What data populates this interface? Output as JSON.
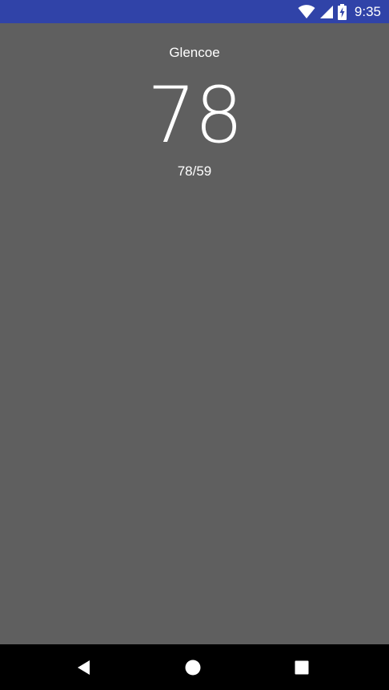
{
  "status_bar": {
    "time": "9:35",
    "icons": [
      "wifi-icon",
      "cell-signal-icon",
      "battery-charging-icon"
    ],
    "color": "#3043a8"
  },
  "weather": {
    "city": "Glencoe",
    "temperature": "78",
    "high_low": "78/59"
  },
  "nav_bar": {
    "buttons": [
      "back-icon",
      "home-icon",
      "recent-apps-icon"
    ]
  },
  "colors": {
    "background": "#5f5f5f",
    "status_bar": "#3043a8",
    "nav_bar": "#000000",
    "text": "#ffffff"
  }
}
